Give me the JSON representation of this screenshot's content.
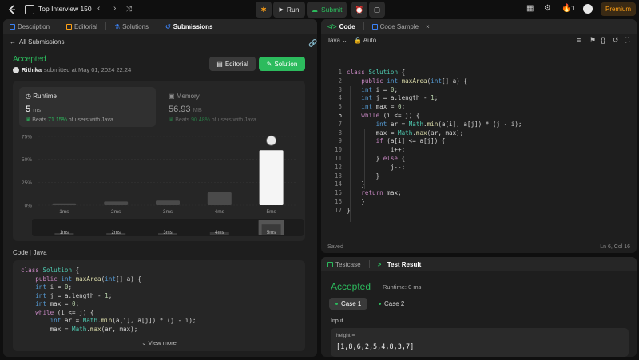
{
  "topbar": {
    "title": "Top Interview 150",
    "run_label": "Run",
    "submit_label": "Submit",
    "streak": "1",
    "premium_label": "Premium"
  },
  "left_tabs": [
    "Description",
    "Editorial",
    "Solutions",
    "Submissions"
  ],
  "submission": {
    "back_label": "All Submissions",
    "status": "Accepted",
    "user": "Rithika",
    "submitted_text": "submitted at May 01, 2024 22:24",
    "editorial_btn": "Editorial",
    "solution_btn": "Solution",
    "runtime": {
      "title": "Runtime",
      "value": "5",
      "unit": "ms",
      "beats_prefix": "Beats",
      "beats_pct": "71.15%",
      "beats_suffix": "of users with Java"
    },
    "memory": {
      "title": "Memory",
      "value": "56.93",
      "unit": "MB",
      "beats_prefix": "Beats",
      "beats_pct": "90.48%",
      "beats_suffix": "of users with Java"
    }
  },
  "chart_data": {
    "type": "bar",
    "categories": [
      "1ms",
      "2ms",
      "3ms",
      "4ms",
      "5ms"
    ],
    "values": [
      2,
      4,
      5,
      14,
      60
    ],
    "highlight_index": 4,
    "ytick_labels": [
      "75%",
      "50%",
      "25%",
      "0%"
    ],
    "yticks": [
      75,
      50,
      25,
      0
    ],
    "ylim": [
      0,
      75
    ],
    "grid": true,
    "minimap_categories": [
      "1ms",
      "2ms",
      "3ms",
      "4ms",
      "5ms"
    ]
  },
  "code_section": {
    "label": "Code",
    "lang": "Java",
    "view_more": "View more",
    "lines": [
      "class Solution {",
      "    public int maxArea(int[] a) {",
      "    int i = 0;",
      "    int j = a.length - 1;",
      "    int max = 0;",
      "    while (i <= j) {",
      "        int ar = Math.min(a[i], a[j]) * (j - i);",
      "        max = Math.max(ar, max);"
    ]
  },
  "editor": {
    "tabs": [
      "Code",
      "Code Sample"
    ],
    "lang": "Java",
    "auto_label": "Auto",
    "saved_label": "Saved",
    "cursor_pos": "Ln 6, Col 16",
    "line_numbers": [
      "1",
      "2",
      "3",
      "4",
      "5",
      "6",
      "7",
      "8",
      "9",
      "10",
      "11",
      "12",
      "13",
      "14",
      "15",
      "16",
      "17"
    ],
    "current_line": 6,
    "lines": [
      "class Solution {",
      "    public int maxArea(int[] a) {",
      "    int i = 0;",
      "    int j = a.length - 1;",
      "    int max = 0;",
      "    while (i <= j) {",
      "        int ar = Math.min(a[i], a[j]) * (j - i);",
      "        max = Math.max(ar, max);",
      "        if (a[i] <= a[j]) {",
      "            i++;",
      "        } else {",
      "            j--;",
      "        }",
      "    }",
      "    return max;",
      "    }",
      "}"
    ]
  },
  "result": {
    "tabs": [
      "Testcase",
      "Test Result"
    ],
    "status": "Accepted",
    "runtime_text": "Runtime: 0 ms",
    "cases": [
      "Case 1",
      "Case 2"
    ],
    "input_label": "Input",
    "param_name": "height =",
    "param_value": "[1,8,6,2,5,4,8,3,7]"
  },
  "colors": {
    "accent_green": "#2cbb5d",
    "premium": "#ffa116",
    "panel": "#1e1e1e",
    "background": "#0f0f0f"
  }
}
